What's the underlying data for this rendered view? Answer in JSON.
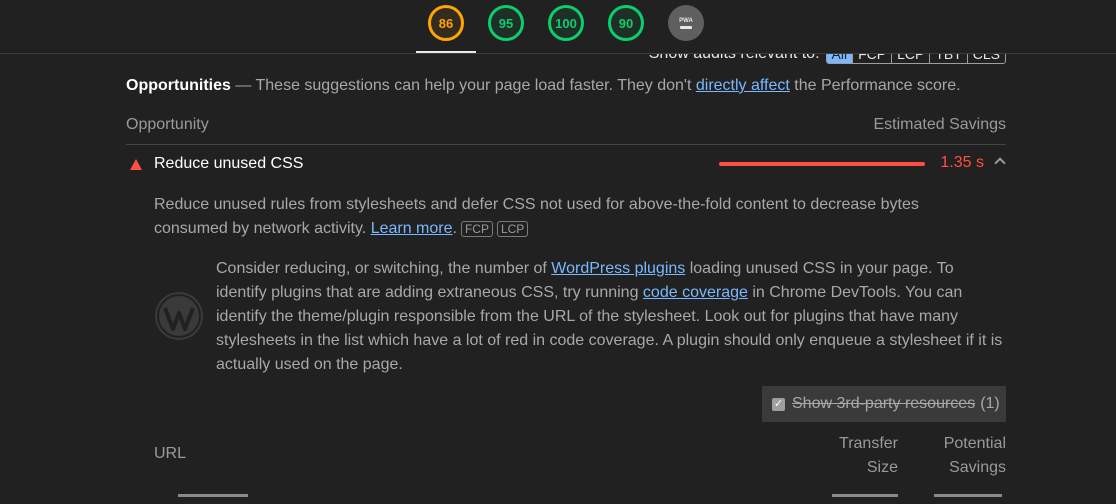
{
  "gauges": [
    {
      "value": "86",
      "color": "#ffa400"
    },
    {
      "value": "95",
      "color": "#0cce6b"
    },
    {
      "value": "100",
      "color": "#0cce6b"
    },
    {
      "value": "90",
      "color": "#0cce6b"
    },
    {
      "value": "PWA",
      "icon": "pwa-icon"
    }
  ],
  "filter": {
    "label": "Show audits relevant to:",
    "chips": [
      "All",
      "FCP",
      "LCP",
      "TBT",
      "CLS"
    ],
    "active": "All"
  },
  "opportunities": {
    "title": "Opportunities",
    "desc_before": " — These suggestions can help your page load faster. They don't ",
    "link": "directly affect",
    "desc_after": " the Performance score."
  },
  "table": {
    "col_opportunity": "Opportunity",
    "col_savings": "Estimated Savings"
  },
  "audit": {
    "icon": "fail-triangle-icon",
    "name": "Reduce unused CSS",
    "savings": "1.35 s",
    "bar_fraction": 1.0,
    "description": "Reduce unused rules from stylesheets and defer CSS not used for above-the-fold content to decrease bytes consumed by network activity. ",
    "learn_more": "Learn more",
    "badges": [
      "FCP",
      "LCP"
    ]
  },
  "stack_pack": {
    "icon": "wordpress-icon",
    "t1": "Consider reducing, or switching, the number of ",
    "link1": "WordPress plugins",
    "t2": " loading unused CSS in your page. To identify plugins that are adding extraneous CSS, try running ",
    "link2": "code coverage",
    "t3": " in Chrome DevTools. You can identify the theme/plugin responsible from the URL of the stylesheet. Look out for plugins that have many stylesheets in the list which have a lot of red in code coverage. A plugin should only enqueue a stylesheet if it is actually used on the page."
  },
  "third_party": {
    "label": "Show 3rd-party resources",
    "count": "(1)",
    "checked": true
  },
  "details": {
    "col_url": "URL",
    "col_transfer_1": "Transfer",
    "col_transfer_2": "Size",
    "col_potential_1": "Potential",
    "col_potential_2": "Savings"
  }
}
